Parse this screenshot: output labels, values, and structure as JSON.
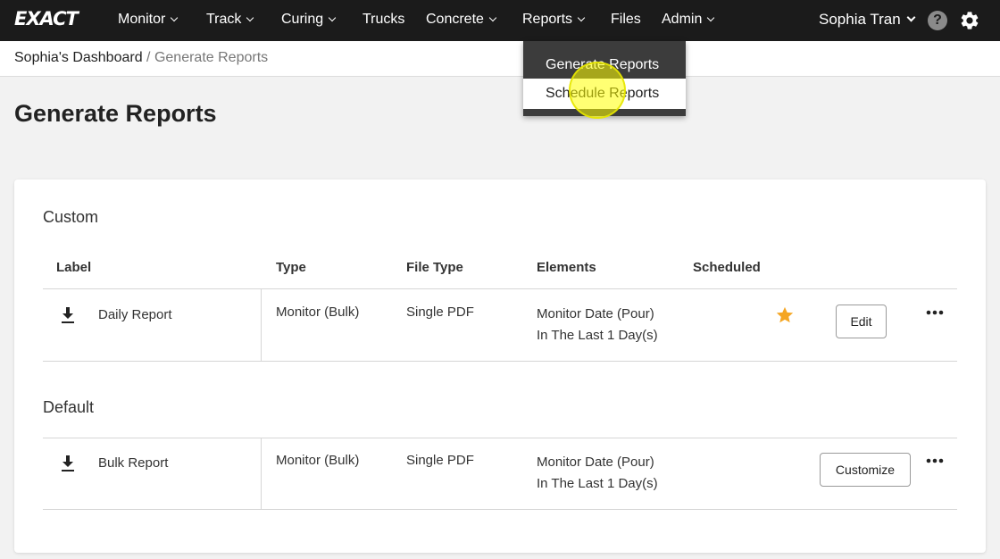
{
  "app": {
    "logo": "EXACT"
  },
  "nav": {
    "items": [
      {
        "label": "Monitor",
        "has_menu": true
      },
      {
        "label": "Track",
        "has_menu": true
      },
      {
        "label": "Curing",
        "has_menu": true
      },
      {
        "label": "Trucks",
        "has_menu": false
      },
      {
        "label": "Concrete",
        "has_menu": true
      },
      {
        "label": "Reports",
        "has_menu": true
      },
      {
        "label": "Files",
        "has_menu": false
      },
      {
        "label": "Admin",
        "has_menu": true
      }
    ],
    "user_name": "Sophia Tran",
    "help_label": "?",
    "icons": {
      "help": "help-circle-icon",
      "settings": "gear-icon"
    }
  },
  "reports_menu": {
    "items": [
      {
        "label": "Generate Reports",
        "state": "current"
      },
      {
        "label": "Schedule Reports",
        "state": "hovered"
      }
    ]
  },
  "breadcrumb": {
    "home": "Sophia's Dashboard",
    "separator": "/",
    "current": "Generate Reports"
  },
  "page": {
    "title": "Generate Reports"
  },
  "table": {
    "columns": [
      "Label",
      "Type",
      "File Type",
      "Elements",
      "Scheduled"
    ],
    "custom": {
      "title": "Custom",
      "rows": [
        {
          "label": "Daily Report",
          "type": "Monitor (Bulk)",
          "file_type": "Single PDF",
          "elements_line1": "Monitor Date (Pour)",
          "elements_line2": "In The Last 1 Day(s)",
          "scheduled": true,
          "action": "Edit"
        }
      ]
    },
    "default": {
      "title": "Default",
      "rows": [
        {
          "label": "Bulk Report",
          "type": "Monitor (Bulk)",
          "file_type": "Single PDF",
          "elements_line1": "Monitor Date (Pour)",
          "elements_line2": "In The Last 1 Day(s)",
          "scheduled": false,
          "action": "Customize"
        }
      ]
    }
  },
  "colors": {
    "nav_bg": "#1b1b1b",
    "star": "#f5a623",
    "dropdown_bg": "#3c3c3c",
    "highlight": "#ffff00"
  }
}
